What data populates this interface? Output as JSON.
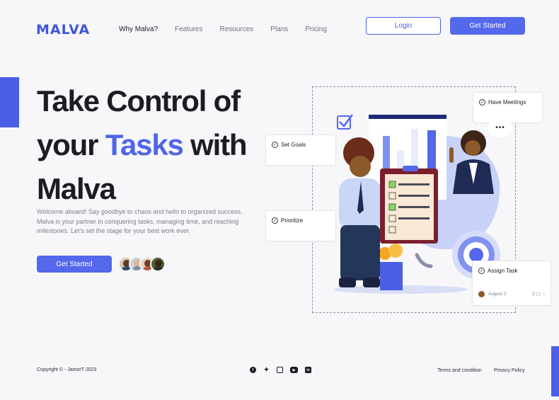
{
  "brand": {
    "logo_text": "MALVA",
    "accent": "#4a5fe3"
  },
  "nav": {
    "items": [
      {
        "label": "Why Malva?",
        "active": true
      },
      {
        "label": "Features"
      },
      {
        "label": "Resources"
      },
      {
        "label": "Plans"
      },
      {
        "label": "Pricing"
      }
    ],
    "login": "Login",
    "cta": "Get Started"
  },
  "hero": {
    "title_line1": "Take Control of",
    "title_line2_pre": "your ",
    "title_line2_highlight": "Tasks",
    "title_line2_post": " with",
    "title_line3": "Malva",
    "description": "Welcome aboard! Say goodbye to chaos and hello to organized success. Malva is your partner in conquering tasks, managing time, and reaching milestones. Let's set the stage for your best work ever.",
    "cta": "Get Started",
    "avatar_count": 4
  },
  "illustration": {
    "cards": {
      "set_goals": "Set Goals",
      "have_meetings": "Have Meetings",
      "prioritize": "Prioritize",
      "assign_task": "Assign Task",
      "assign_date": "August 2",
      "assign_comments": "2",
      "meeting_dots": "•••"
    }
  },
  "footer": {
    "copyright": "Copyright © - JamorT 2023",
    "socials": [
      "facebook-icon",
      "twitter-icon",
      "instagram-icon",
      "youtube-icon",
      "linkedin-icon"
    ],
    "links": [
      "Terms and condition",
      "Privacy Policy"
    ]
  }
}
